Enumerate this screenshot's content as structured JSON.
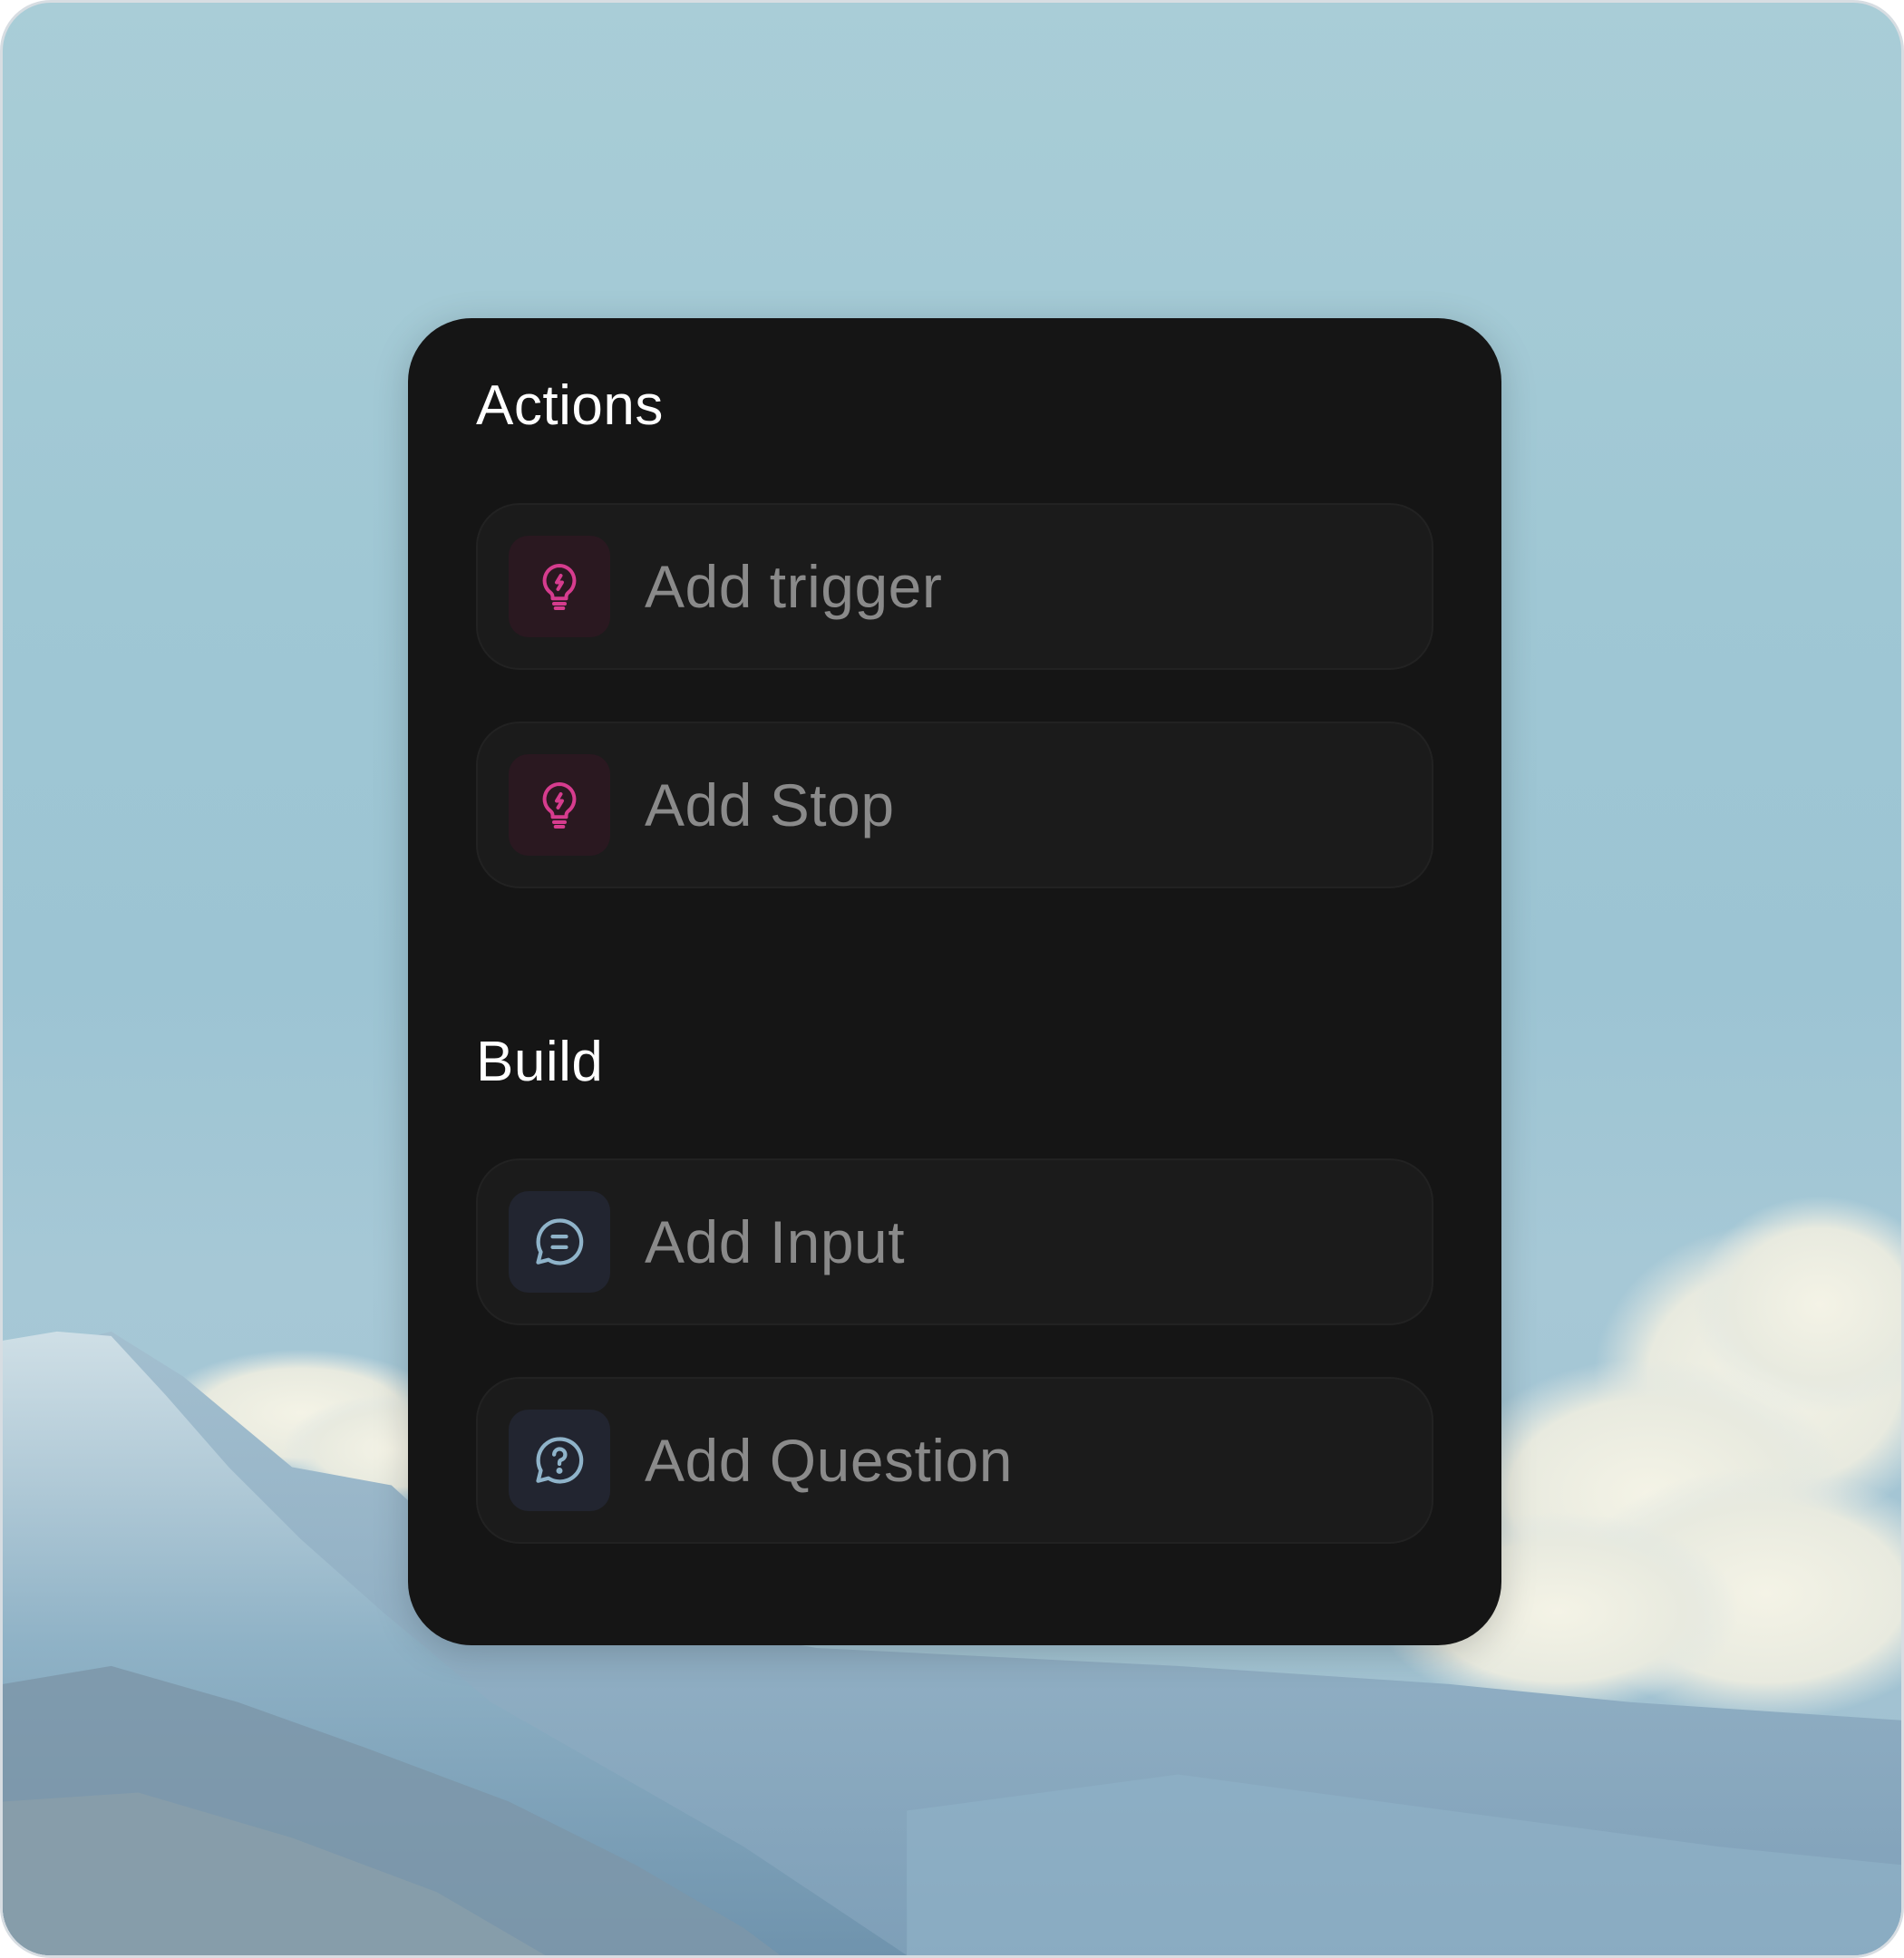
{
  "sections": {
    "actions": {
      "title": "Actions",
      "items": [
        {
          "label": "Add trigger",
          "icon": "lightbulb-bolt-icon"
        },
        {
          "label": "Add Stop",
          "icon": "lightbulb-bolt-icon"
        }
      ]
    },
    "build": {
      "title": "Build",
      "items": [
        {
          "label": "Add Input",
          "icon": "chat-lines-icon"
        },
        {
          "label": "Add Question",
          "icon": "chat-question-icon"
        }
      ]
    }
  },
  "colors": {
    "panel_background": "#151515",
    "item_background": "#1b1b1b",
    "title_text": "#ffffff",
    "item_text": "#8a8a8a",
    "accent_pink": "#d63c8e",
    "accent_blue": "#8fb3c9"
  }
}
